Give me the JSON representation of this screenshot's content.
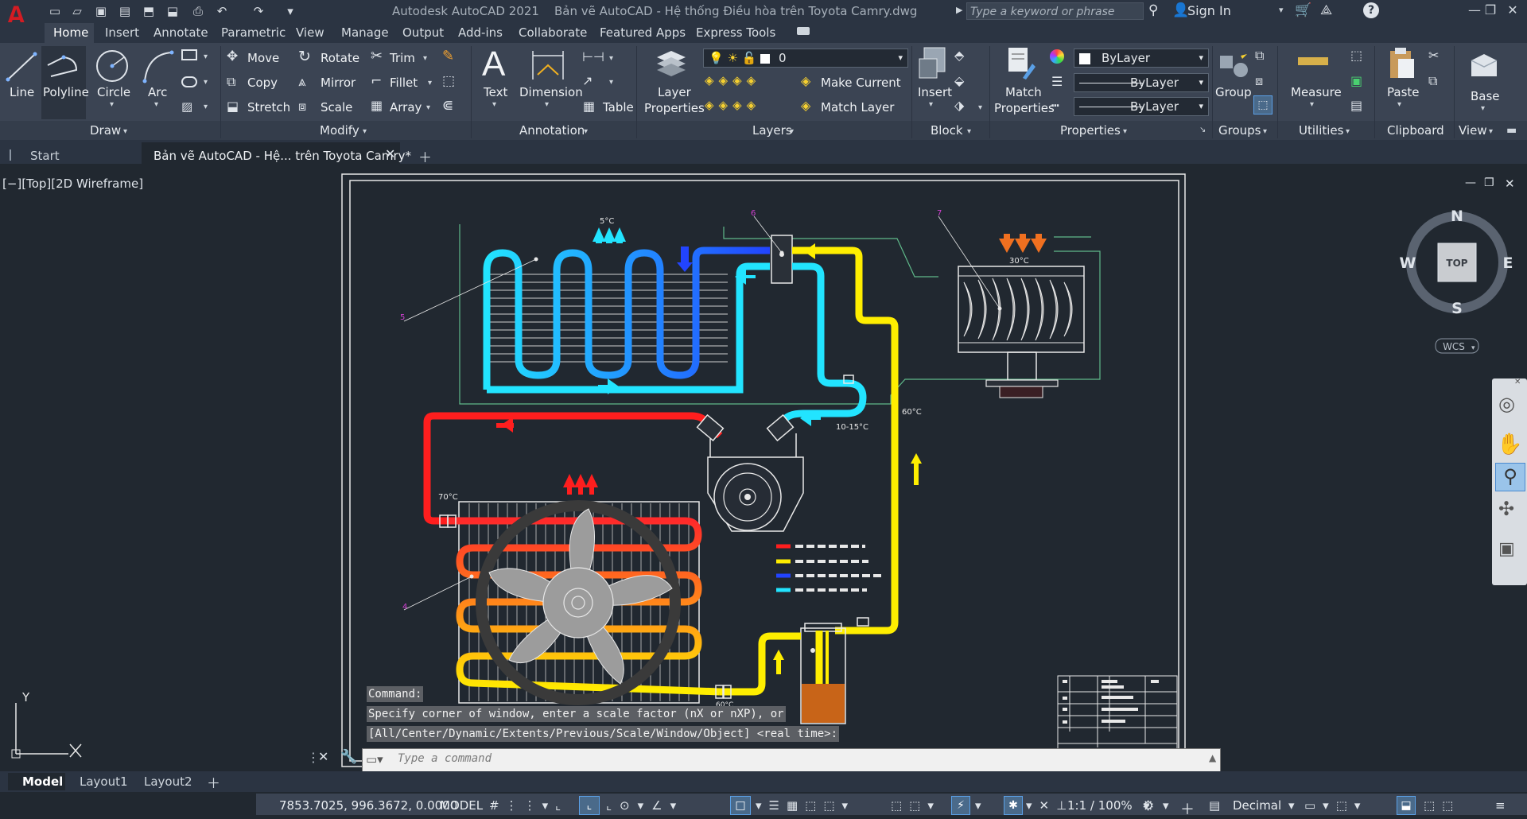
{
  "app": {
    "logo": "A",
    "title": "Autodesk AutoCAD 2021",
    "document": "Bản vẽ AutoCAD - Hệ thống Điều hòa trên Toyota Camry.dwg",
    "search_placeholder": "Type a keyword or phrase",
    "sign_in": "Sign In"
  },
  "ribbon_tabs": [
    "Home",
    "Insert",
    "Annotate",
    "Parametric",
    "View",
    "Manage",
    "Output",
    "Add-ins",
    "Collaborate",
    "Featured Apps",
    "Express Tools"
  ],
  "panels": {
    "draw": {
      "label": "Draw",
      "line": "Line",
      "polyline": "Polyline",
      "circle": "Circle",
      "arc": "Arc"
    },
    "modify": {
      "label": "Modify",
      "move": "Move",
      "rotate": "Rotate",
      "trim": "Trim",
      "copy": "Copy",
      "mirror": "Mirror",
      "fillet": "Fillet",
      "stretch": "Stretch",
      "scale": "Scale",
      "array": "Array"
    },
    "annotation": {
      "label": "Annotation",
      "text": "Text",
      "dimension": "Dimension",
      "table": "Table"
    },
    "layers": {
      "label": "Layers",
      "layer_properties_1": "Layer",
      "layer_properties_2": "Properties",
      "current_layer": "0",
      "make_current": "Make Current",
      "match_layer": "Match Layer"
    },
    "block": {
      "label": "Block",
      "insert": "Insert"
    },
    "properties": {
      "label": "Properties",
      "match_1": "Match",
      "match_2": "Properties",
      "color": "ByLayer",
      "linetype": "ByLayer",
      "lineweight": "ByLayer"
    },
    "groups": {
      "label": "Groups",
      "group": "Group"
    },
    "utilities": {
      "label": "Utilities",
      "measure": "Measure"
    },
    "clipboard": {
      "label": "Clipboard",
      "paste": "Paste"
    },
    "view": {
      "label": "View",
      "base": "Base"
    }
  },
  "doc_tabs": {
    "start": "Start",
    "active": "Bản vẽ AutoCAD - Hệ... trên Toyota Camry*"
  },
  "viewport": {
    "label": "[−][Top][2D Wireframe]"
  },
  "viewcube": {
    "n": "N",
    "s": "S",
    "e": "E",
    "w": "W",
    "top": "TOP",
    "wcs": "WCS"
  },
  "ucs": {
    "y": "Y"
  },
  "drawing": {
    "temp_evap_out": "5°C",
    "temp_cabin": "30°C",
    "temp_60": "60°C",
    "temp_10_15": "10-15°C",
    "temp_70": "70°C",
    "temp_60_low": "60°C",
    "callout_5": "5",
    "callout_4": "4",
    "callout_6": "6",
    "callout_7": "7"
  },
  "command": {
    "history": [
      "Command:",
      "Specify corner of window, enter a scale factor (nX or nXP), or",
      "[All/Center/Dynamic/Extents/Previous/Scale/Window/Object] <real time>:"
    ],
    "placeholder": "Type a command"
  },
  "layout_tabs": [
    "Model",
    "Layout1",
    "Layout2"
  ],
  "status": {
    "coords": "7853.7025, 996.3672, 0.0000",
    "space": "MODEL",
    "scale": "1:1 / 100%",
    "units": "Decimal"
  },
  "colors": {
    "hot": "#ff1e1e",
    "warm": "#ffee00",
    "cold_blue": "#2244ff",
    "cold_cyan": "#22e4ff",
    "ribbon_bg": "#3b4453"
  }
}
